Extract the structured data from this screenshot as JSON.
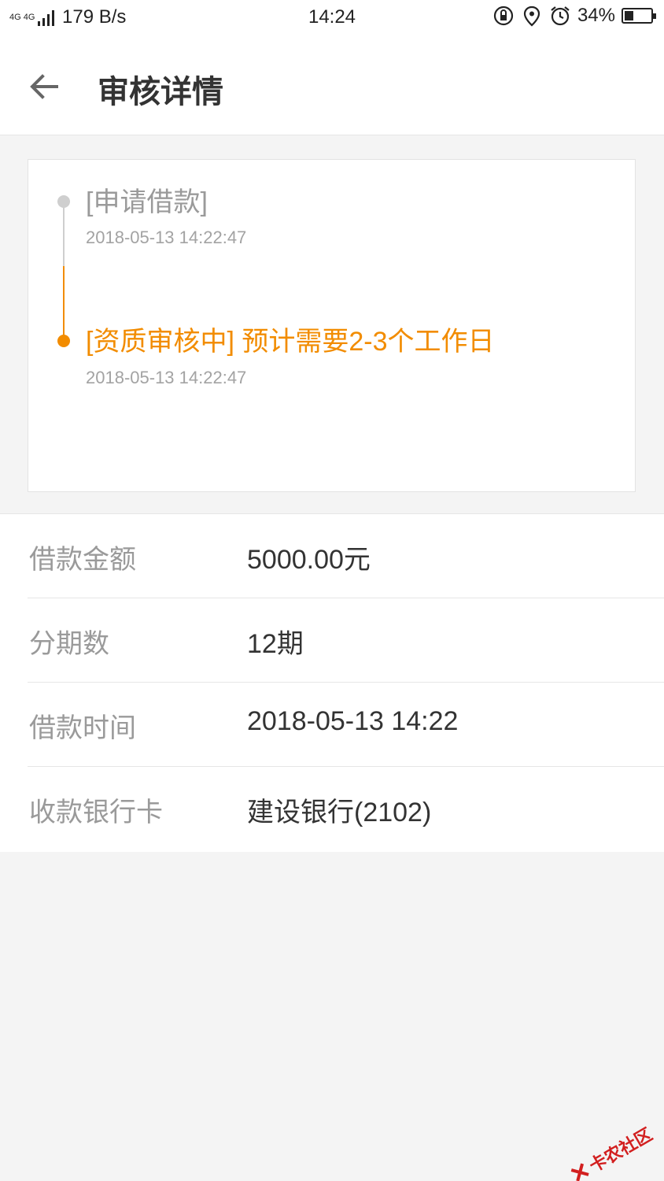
{
  "status_bar": {
    "network": "4G 4G",
    "speed": "179 B/s",
    "time": "14:24",
    "battery_text": "34%",
    "battery_level": 0.34
  },
  "header": {
    "title": "审核详情",
    "back_icon": "arrow-left-icon"
  },
  "timeline": [
    {
      "title": "[申请借款]",
      "time": "2018-05-13 14:22:47",
      "state": "done"
    },
    {
      "title": "[资质审核中] 预计需要2-3个工作日",
      "time": "2018-05-13 14:22:47",
      "state": "current"
    }
  ],
  "details": [
    {
      "label": "借款金额",
      "value": "5000.00元"
    },
    {
      "label": "分期数",
      "value": "12期"
    },
    {
      "label": "借款时间",
      "value": "2018-05-13 14:22"
    },
    {
      "label": "收款银行卡",
      "value": "建设银行(2102)"
    }
  ],
  "watermark": {
    "text": "卡农社区"
  },
  "colors": {
    "accent": "#f28c00",
    "muted": "#9a9a9a",
    "background": "#f4f4f4"
  }
}
